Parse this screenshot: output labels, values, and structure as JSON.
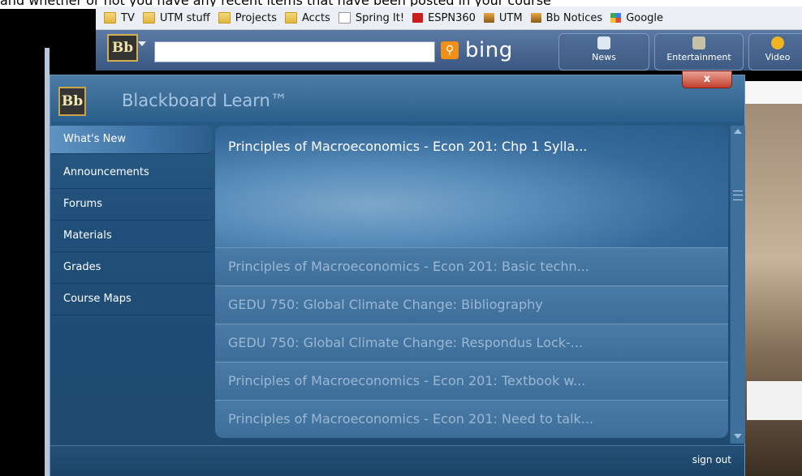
{
  "caption": "and whether or not you have any recent items that have been posted in your course",
  "bookmarks": [
    {
      "label": "TV",
      "icon": "folder-icon"
    },
    {
      "label": "UTM stuff",
      "icon": "folder-icon"
    },
    {
      "label": "Projects",
      "icon": "folder-icon"
    },
    {
      "label": "Accts",
      "icon": "folder-icon"
    },
    {
      "label": "Spring It!",
      "icon": "page-icon"
    },
    {
      "label": "ESPN360",
      "icon": "espn-icon"
    },
    {
      "label": "UTM",
      "icon": "utm-icon"
    },
    {
      "label": "Bb Notices",
      "icon": "utm-icon"
    },
    {
      "label": "Google",
      "icon": "google-icon"
    }
  ],
  "toolbar": {
    "brand": "bing",
    "news_label": "News",
    "entertainment_label": "Entertainment",
    "video_label": "Video",
    "search_placeholder": ""
  },
  "bb": {
    "logo_text": "Bb",
    "title": "Blackboard Learn™",
    "close_label": "x",
    "nav": [
      {
        "label": "What's New",
        "active": true
      },
      {
        "label": "Announcements",
        "active": false
      },
      {
        "label": "Forums",
        "active": false
      },
      {
        "label": "Materials",
        "active": false
      },
      {
        "label": "Grades",
        "active": false
      },
      {
        "label": "Course Maps",
        "active": false
      }
    ],
    "featured": "Principles of Macroeconomics - Econ 201: Chp 1 Sylla...",
    "items": [
      "Principles of Macroeconomics - Econ 201: Basic techn...",
      "GEDU 750: Global Climate Change: Bibliography",
      "GEDU 750: Global Climate Change: Respondus Lock-...",
      "Principles of Macroeconomics - Econ 201: Textbook w...",
      "Principles of Macroeconomics - Econ 201: Need to talk..."
    ],
    "signout": "sign out"
  },
  "colors": {
    "panel": "#1f4e78",
    "accent_close": "#c2402d",
    "bing_button": "#f28f17"
  }
}
